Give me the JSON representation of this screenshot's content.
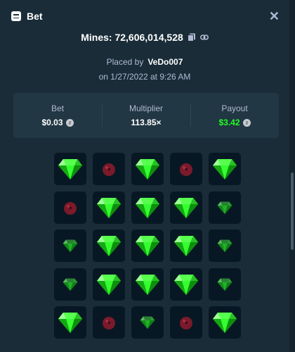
{
  "header": {
    "title": "Bet"
  },
  "mines": {
    "label": "Mines: 72,606,014,528"
  },
  "placed": {
    "prefix": "Placed by",
    "user": "VeDo007",
    "date": "on 1/27/2022 at 9:26 AM"
  },
  "stats": {
    "bet": {
      "label": "Bet",
      "value": "$0.03"
    },
    "multiplier": {
      "label": "Multiplier",
      "value": "113.85×"
    },
    "payout": {
      "label": "Payout",
      "value": "$3.42"
    }
  },
  "colors": {
    "background": "#1a2c38",
    "payout": "#1fff20",
    "gem": "#1fff20",
    "mine": "#7a1a2a"
  },
  "grid": [
    [
      "gem",
      "mine",
      "gem",
      "mine",
      "gem"
    ],
    [
      "mine",
      "gem",
      "gem",
      "gem",
      "gem-dim"
    ],
    [
      "gem-dim",
      "gem",
      "gem",
      "gem",
      "gem-dim"
    ],
    [
      "gem-dim",
      "gem",
      "gem",
      "gem",
      "gem-dim"
    ],
    [
      "gem",
      "mine",
      "gem-dim",
      "mine",
      "gem"
    ]
  ]
}
